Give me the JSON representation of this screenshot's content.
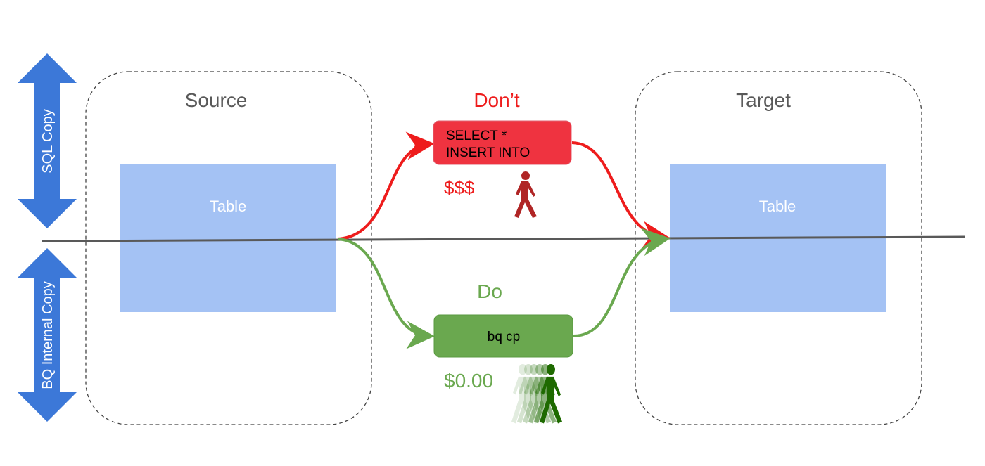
{
  "left_axis": {
    "top_label": "SQL Copy",
    "bottom_label": "BQ Internal Copy",
    "color": "#3c78d8"
  },
  "source": {
    "title": "Source",
    "table_label": "Table"
  },
  "target": {
    "title": "Target",
    "table_label": "Table"
  },
  "dont": {
    "heading": "Don’t",
    "box_line1": "SELECT *",
    "box_line2": "INSERT INTO",
    "cost": "$$$",
    "color": "#ee1c1c",
    "box_color": "#ef3340",
    "icon": "walking-person-icon"
  },
  "do": {
    "heading": "Do",
    "box_label": "bq cp",
    "cost": "$0.00",
    "color": "#6aa84f",
    "icon": "fast-walking-person-icon"
  },
  "table_color": "#a4c2f4"
}
